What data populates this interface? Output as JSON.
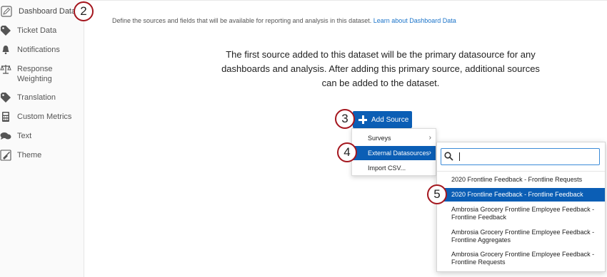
{
  "sidebar": {
    "items": [
      {
        "label": "Dashboard Data",
        "icon": "pencil-icon",
        "active": true
      },
      {
        "label": "Ticket Data",
        "icon": "tag-icon"
      },
      {
        "label": "Notifications",
        "icon": "bell-icon"
      },
      {
        "label": "Response\nWeighting",
        "icon": "scale-icon"
      },
      {
        "label": "Translation",
        "icon": "tag-icon"
      },
      {
        "label": "Custom Metrics",
        "icon": "calculator-icon"
      },
      {
        "label": "Text",
        "icon": "chat-bubbles-icon"
      },
      {
        "label": "Theme",
        "icon": "paint-brush-icon"
      }
    ]
  },
  "main": {
    "description": "Define the sources and fields that will be available for reporting and analysis in this dataset.",
    "learn_link": "Learn about Dashboard Data",
    "intro": "The first source added to this dataset will be the primary datasource for any dashboards and analysis. After adding this primary source, additional sources can be added to the dataset."
  },
  "add_source": {
    "label": "Add Source"
  },
  "source_menu": {
    "items": [
      {
        "label": "Surveys",
        "has_submenu": true
      },
      {
        "label": "External Datasources",
        "has_submenu": true,
        "selected": true
      },
      {
        "label": "Import CSV...",
        "has_submenu": false
      }
    ]
  },
  "datasource_submenu": {
    "search_value": "",
    "options": [
      {
        "label": "2020 Frontline Feedback - Frontline Requests"
      },
      {
        "label": "2020 Frontline Feedback - Frontline Feedback",
        "selected": true
      },
      {
        "label": "Ambrosia Grocery Frontline Employee Feedback - Frontline Feedback"
      },
      {
        "label": "Ambrosia Grocery Frontline Employee Feedback - Frontline Aggregates"
      },
      {
        "label": "Ambrosia Grocery Frontline Employee Feedback - Frontline Requests"
      }
    ]
  },
  "callouts": [
    "2",
    "3",
    "4",
    "5"
  ],
  "colors": {
    "accent": "#0b5eb5",
    "callout_border": "#a4161e",
    "link": "#1a73c9"
  }
}
